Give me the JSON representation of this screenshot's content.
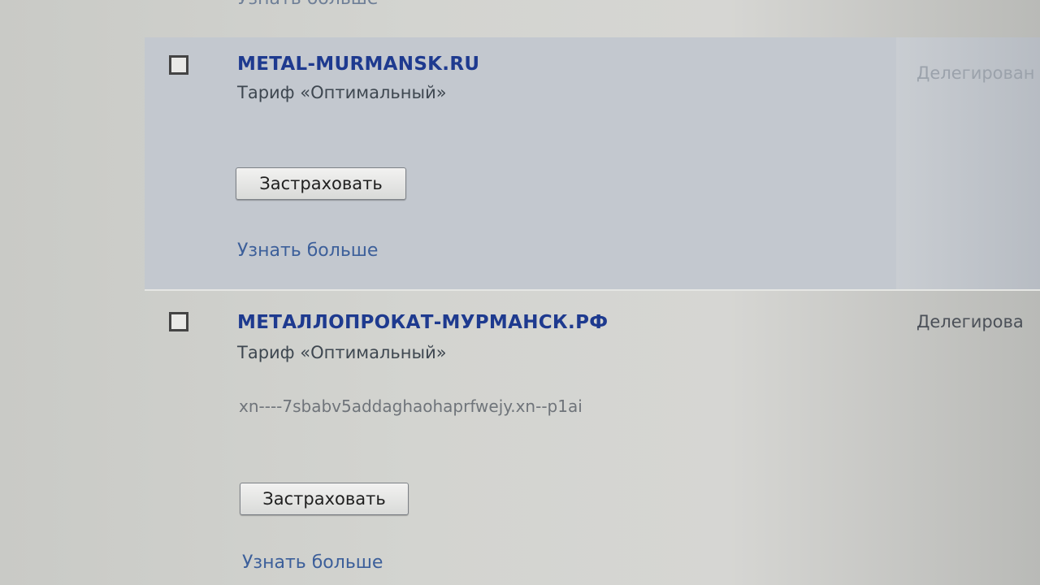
{
  "top_more_link": "Узнать больше",
  "domains": [
    {
      "name": "METAL-MURMANSK.RU",
      "tariff": "Тариф «Оптимальный»",
      "insure_button": "Застраховать",
      "more_link": "Узнать больше",
      "status": "Делегирован"
    },
    {
      "name": "МЕТАЛЛОПРОКАТ-МУРМАНСК.РФ",
      "tariff": "Тариф «Оптимальный»",
      "punycode": "xn----7sbabv5addaghaohaprfwejy.xn--p1ai",
      "insure_button": "Застраховать",
      "more_link": "Узнать больше",
      "status": "Делегирова"
    }
  ]
}
